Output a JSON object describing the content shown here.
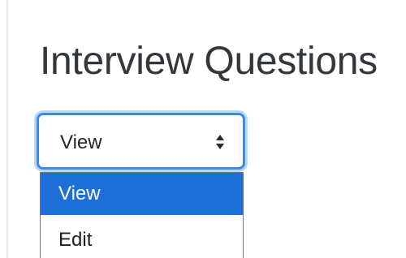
{
  "page": {
    "title": "Interview Questions"
  },
  "mode_select": {
    "value": "View",
    "caret_icon": "up-down-caret-icon",
    "options": [
      {
        "label": "View",
        "selected": true
      },
      {
        "label": "Edit",
        "selected": false
      }
    ]
  },
  "colors": {
    "focus_border": "#3c8ce6",
    "focus_ring": "#bcd8f7",
    "selected_option_bg": "#1e6ed8",
    "title_text": "#33363a"
  }
}
